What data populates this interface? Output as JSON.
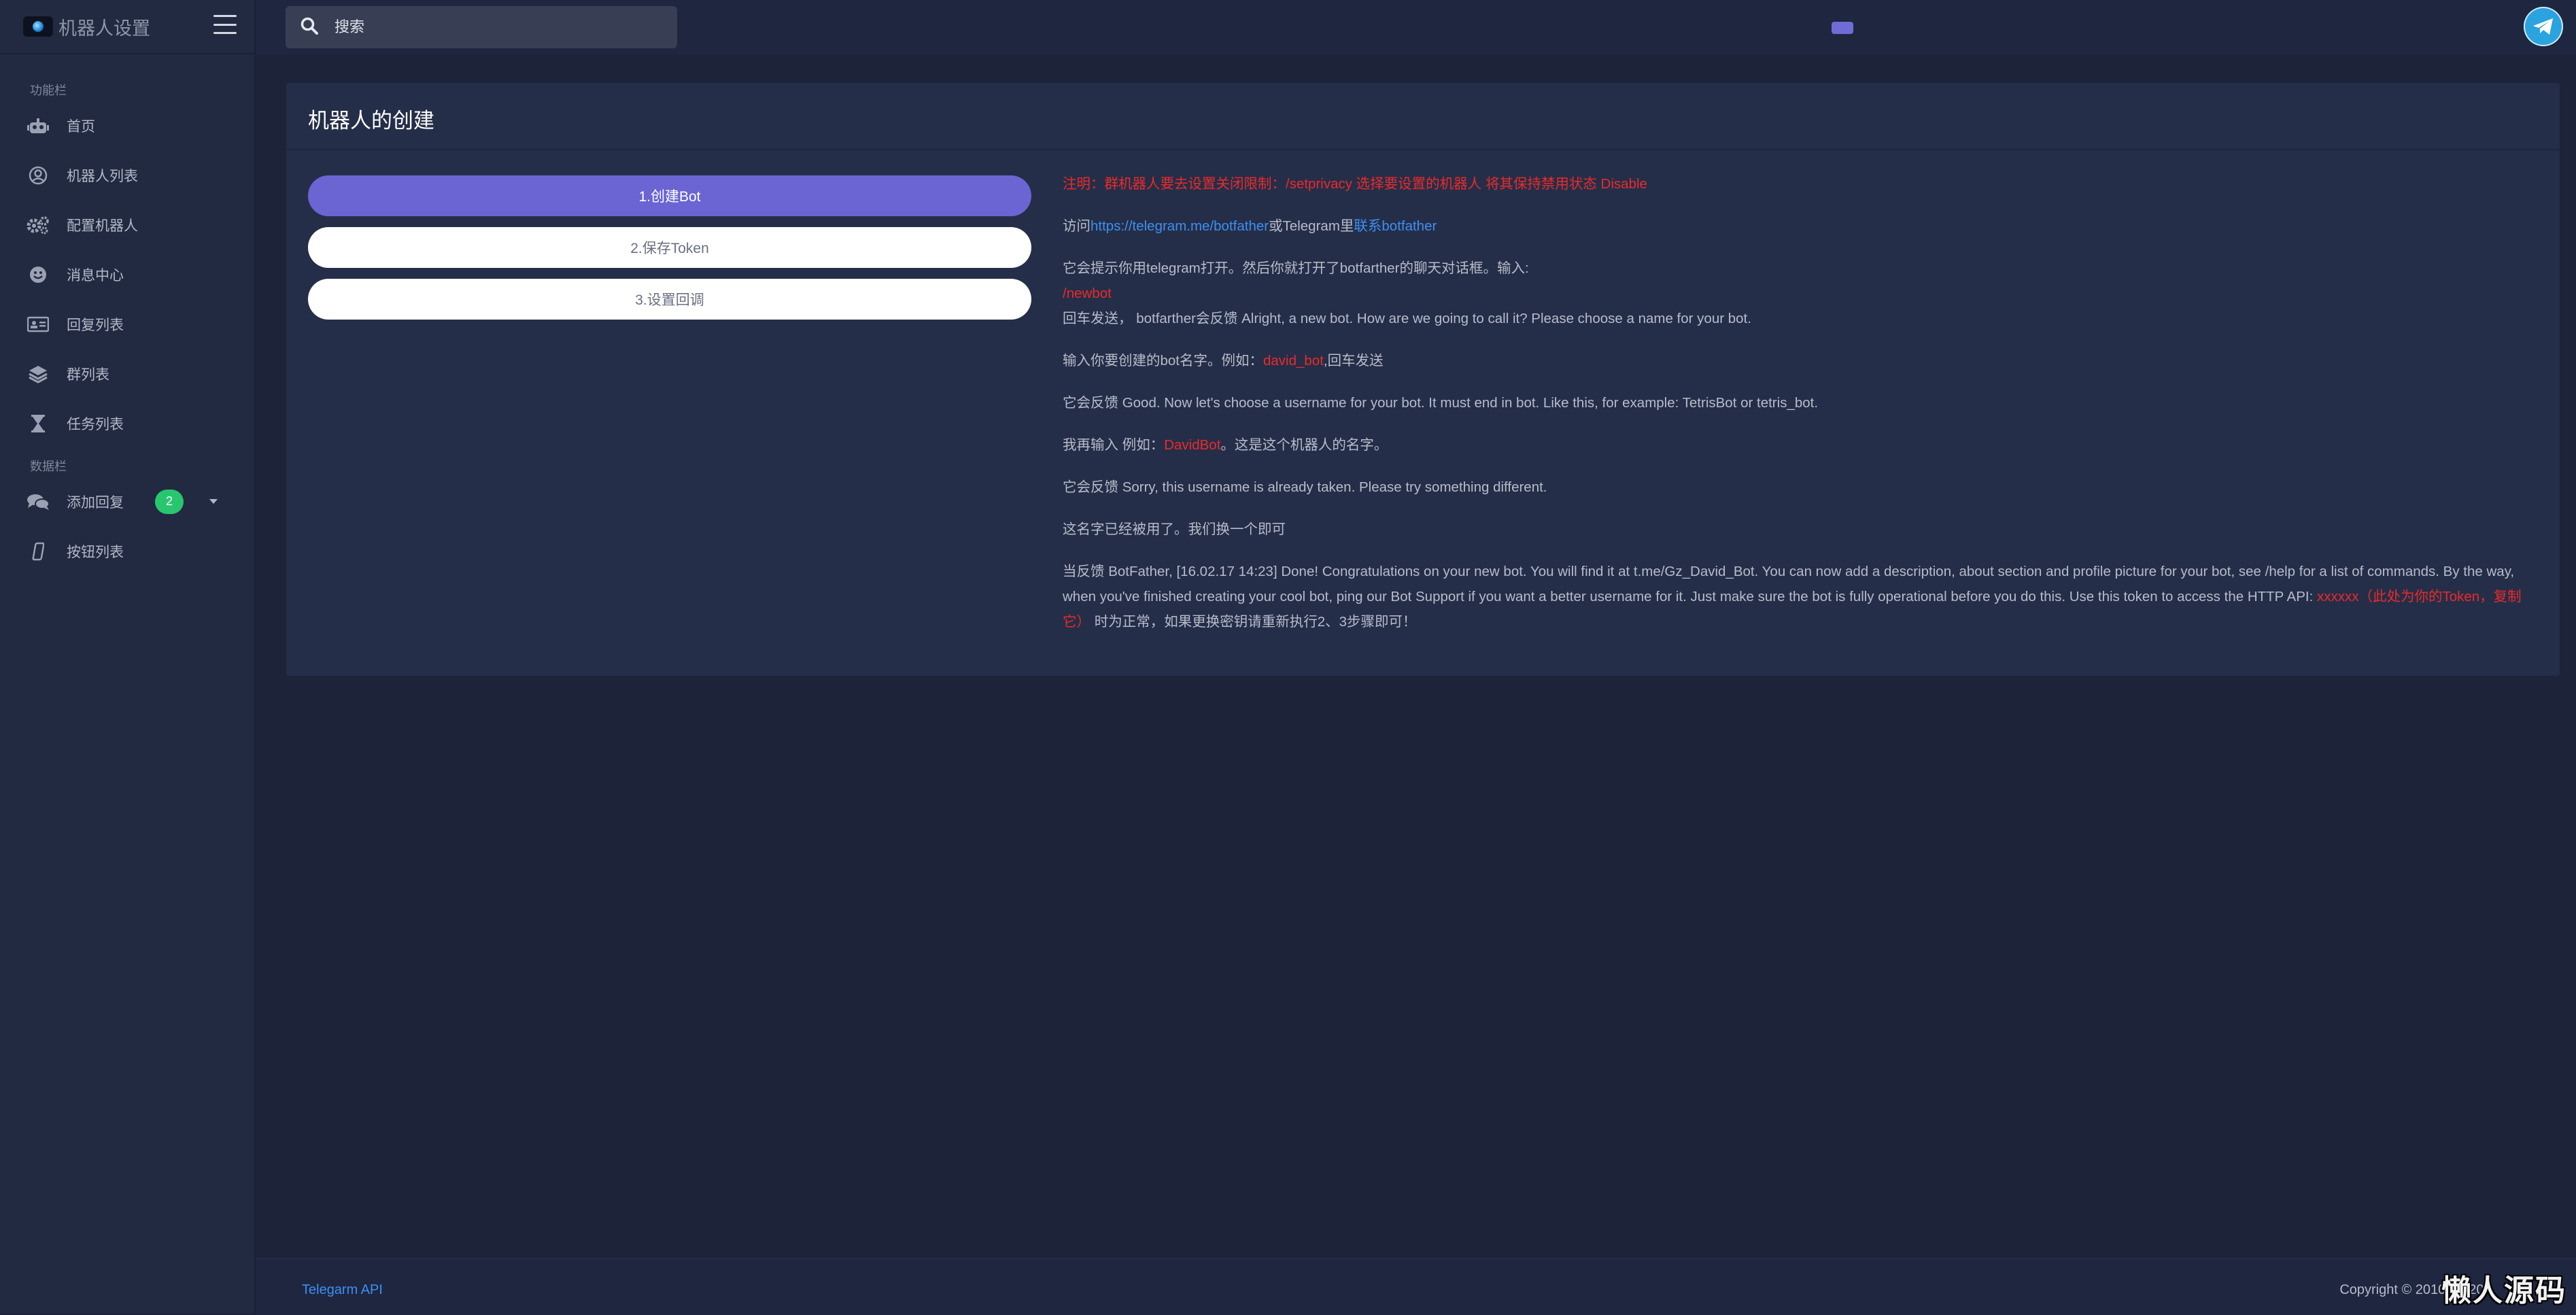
{
  "brand": {
    "title": "机器人设置"
  },
  "sidebar": {
    "section1": "功能栏",
    "section2": "数据栏",
    "items": [
      {
        "label": "首页",
        "icon": "robot-icon"
      },
      {
        "label": "机器人列表",
        "icon": "user-circle-icon"
      },
      {
        "label": "配置机器人",
        "icon": "gears-icon"
      },
      {
        "label": "消息中心",
        "icon": "smile-icon"
      },
      {
        "label": "回复列表",
        "icon": "id-card-icon"
      },
      {
        "label": "群列表",
        "icon": "layers-icon"
      },
      {
        "label": "任务列表",
        "icon": "hourglass-icon"
      },
      {
        "label": "添加回复",
        "icon": "comments-icon",
        "badge": "2"
      },
      {
        "label": "按钮列表",
        "icon": "mobile-icon"
      }
    ]
  },
  "search": {
    "placeholder": "搜索"
  },
  "card": {
    "title": "机器人的创建",
    "steps": [
      "1.创建Bot",
      "2.保存Token",
      "3.设置回调"
    ],
    "notes": {
      "n1": "注明：群机器人要去设置关闭限制：/setprivacy 选择要设置的机器人 将其保持禁用状态 Disable",
      "n2_a": "访问",
      "n2_link1": "https://telegram.me/botfather",
      "n2_b": "或Telegram里",
      "n2_link2": "联系botfather",
      "n3_a": "它会提示你用telegram打开。然后你就打开了botfarther的聊天对话框。输入:",
      "n3_cmd": "/newbot",
      "n3_b": "回车发送， botfarther会反馈 Alright, a new bot. How are we going to call it? Please choose a name for your bot.",
      "n4_a": "输入你要创建的bot名字。例如：",
      "n4_red": "david_bot",
      "n4_b": ",回车发送",
      "n5": "它会反馈 Good. Now let's choose a username for your bot. It must end in bot. Like this, for example: TetrisBot or tetris_bot.",
      "n6_a": "我再输入 例如：",
      "n6_red": "DavidBot",
      "n6_b": "。这是这个机器人的名字。",
      "n7": "它会反馈 Sorry, this username is already taken. Please try something different.",
      "n8": "这名字已经被用了。我们换一个即可",
      "n9_a": "当反馈 BotFather, [16.02.17 14:23] Done! Congratulations on your new bot. You will find it at t.me/Gz_David_Bot. You can now add a description, about section and profile picture for your bot, see /help for a list of commands. By the way, when you've finished creating your cool bot, ping our Bot Support if you want a better username for it. Just make sure the bot is fully operational before you do this. Use this token to access the HTTP API: ",
      "n9_red": "xxxxxx（此处为你的Token，复制它）",
      "n9_b": " 时为正常，如果更换密钥请重新执行2、3步骤即可！"
    }
  },
  "footer": {
    "left": "Telegarm API",
    "right": "Copyright © 2010~2020."
  },
  "watermark": "懒人源码",
  "colors": {
    "accent": "#6b64d3",
    "badge": "#28c76f",
    "danger": "#ea2a2a",
    "link": "#3c8ff2"
  }
}
